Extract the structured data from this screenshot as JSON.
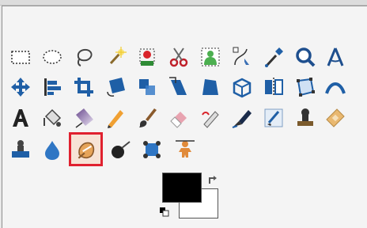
{
  "toolbox": {
    "active_tool": "heal",
    "rows": [
      [
        "rect-select",
        "ellipse-select",
        "free-select",
        "fuzzy-select",
        "color-select",
        "scissors-select",
        "foreground-select",
        "paths",
        "color-picker",
        "zoom",
        "measure"
      ],
      [
        "move",
        "align",
        "crop",
        "rotate",
        "scale",
        "shear",
        "perspective",
        "3d-transform",
        "flip",
        "cage-transform",
        "warp-transform"
      ],
      [
        "text",
        "bucket-fill",
        "blend",
        "pencil",
        "paintbrush",
        "eraser",
        "airbrush",
        "ink",
        "mypaint-brush",
        "clone",
        "heal"
      ],
      [
        "perspective-clone",
        "blur-sharpen",
        "heal-active",
        "dodge-burn",
        "smudge",
        "unified-transform"
      ]
    ]
  },
  "colors": {
    "foreground": "#000000",
    "background": "#ffffff",
    "highlight_border": "#e0212f"
  }
}
